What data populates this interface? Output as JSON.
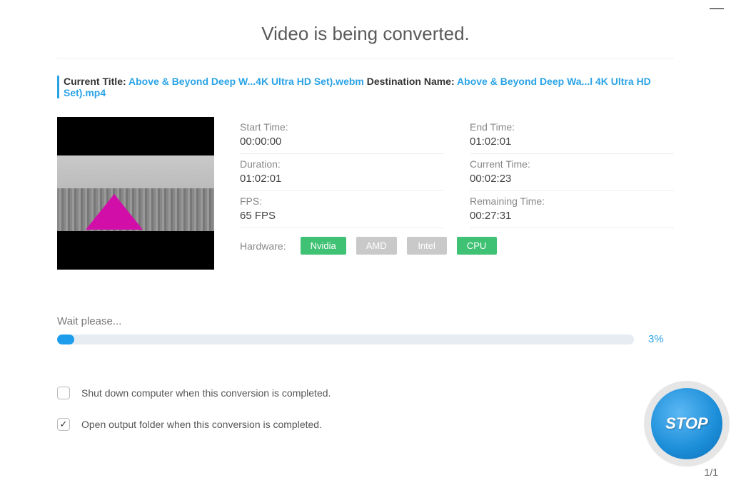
{
  "heading": "Video is being converted.",
  "file": {
    "current_label": "Current Title:",
    "current_name": "Above & Beyond Deep W...4K Ultra HD Set).webm",
    "dest_label": "Destination Name:",
    "dest_name": "Above & Beyond Deep Wa...l 4K Ultra HD Set).mp4"
  },
  "info": {
    "start_time": {
      "label": "Start Time:",
      "value": "00:00:00"
    },
    "end_time": {
      "label": "End Time:",
      "value": "01:02:01"
    },
    "duration": {
      "label": "Duration:",
      "value": "01:02:01"
    },
    "current_time": {
      "label": "Current Time:",
      "value": "00:02:23"
    },
    "fps": {
      "label": "FPS:",
      "value": "65 FPS"
    },
    "remaining": {
      "label": "Remaining Time:",
      "value": "00:27:31"
    }
  },
  "hardware": {
    "label": "Hardware:",
    "nvidia": "Nvidia",
    "amd": "AMD",
    "intel": "Intel",
    "cpu": "CPU"
  },
  "progress": {
    "wait": "Wait please...",
    "percent_text": "3%",
    "percent": 3
  },
  "options": {
    "shutdown": "Shut down computer when this conversion is completed.",
    "open_folder": "Open output folder when this conversion is completed."
  },
  "stop": "STOP",
  "page_count": "1/1"
}
